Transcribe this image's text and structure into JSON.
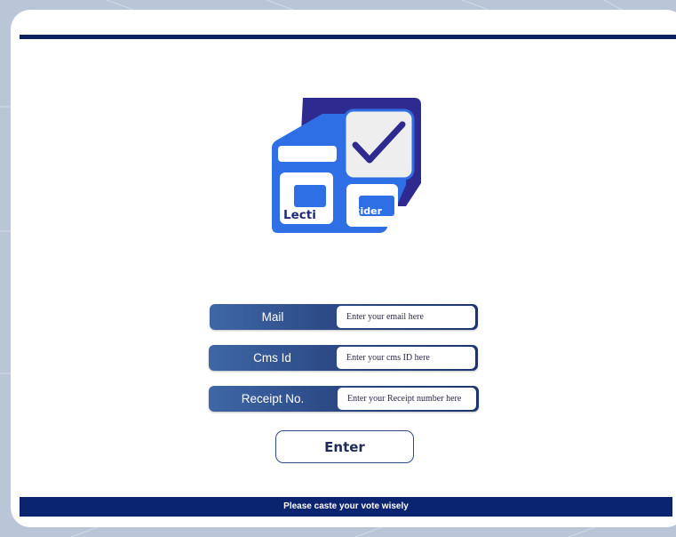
{
  "logo": {
    "text_left": "Lecti",
    "text_right": "cider"
  },
  "form": {
    "mail": {
      "label": "Mail",
      "placeholder": "Enter your email here"
    },
    "cms": {
      "label": "Cms Id",
      "placeholder": "Enter your cms ID here"
    },
    "receipt": {
      "label": "Receipt No.",
      "placeholder": "Enter your Receipt number here"
    },
    "submit_label": "Enter"
  },
  "footer": {
    "text": "Please caste your vote wisely"
  },
  "colors": {
    "navy": "#0c2260",
    "accent_blue": "#2f6fe6",
    "background": "#b9c6d8"
  }
}
